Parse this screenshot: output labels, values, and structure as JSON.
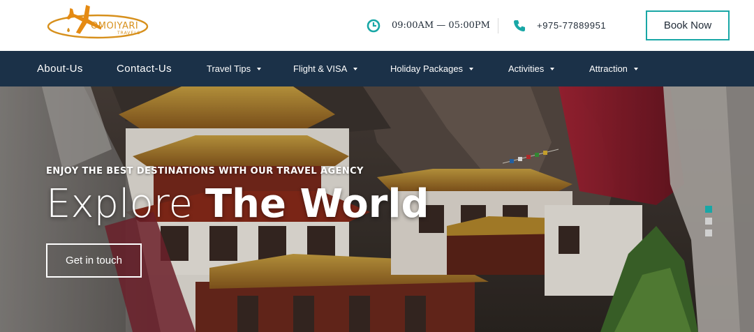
{
  "header": {
    "logo_text": "OMOIYARI",
    "logo_subtext": "TRAVELS",
    "hours": "09:00AM — 05:00PM",
    "phone": "+975-77889951",
    "book_now_label": "Book Now",
    "icons": {
      "hours": "clock-icon",
      "phone": "phone-icon"
    },
    "colors": {
      "accent": "#19a7a6",
      "logo": "#d7901c"
    }
  },
  "nav": {
    "background": "#1b3148",
    "items": [
      {
        "label": "About-Us",
        "has_dropdown": false
      },
      {
        "label": "Contact-Us",
        "has_dropdown": false
      },
      {
        "label": "Travel Tips",
        "has_dropdown": true
      },
      {
        "label": "Flight & VISA",
        "has_dropdown": true
      },
      {
        "label": "Holiday Packages",
        "has_dropdown": true
      },
      {
        "label": "Activities",
        "has_dropdown": true
      },
      {
        "label": "Attraction",
        "has_dropdown": true
      }
    ]
  },
  "hero": {
    "eyebrow": "ENJOY THE BEST DESTINATIONS WITH OUR TRAVEL AGENCY",
    "title_light": "Explore",
    "title_bold": "The World",
    "cta_label": "Get in touch",
    "slider": {
      "total": 3,
      "active": 1,
      "active_color": "#19a7a6",
      "inactive_color": "#d0d0d0"
    }
  }
}
